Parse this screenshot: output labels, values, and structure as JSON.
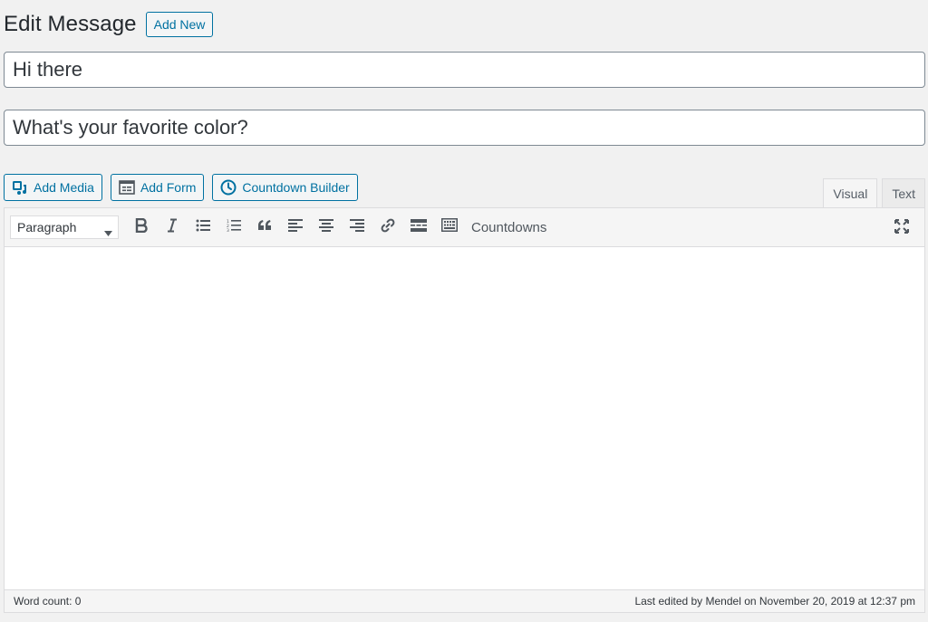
{
  "header": {
    "title": "Edit Message",
    "add_new_label": "Add New"
  },
  "fields": {
    "title_value": "Hi there",
    "subject_value": "What's your favorite color?"
  },
  "media_buttons": [
    {
      "label": "Add Media",
      "icon": "add-media-icon"
    },
    {
      "label": "Add Form",
      "icon": "form-icon"
    },
    {
      "label": "Countdown Builder",
      "icon": "clock-icon"
    }
  ],
  "tabs": {
    "visual": "Visual",
    "text": "Text",
    "active": "Visual"
  },
  "toolbar": {
    "format_selected": "Paragraph",
    "buttons": [
      "bold-icon",
      "italic-icon",
      "bulleted-list-icon",
      "numbered-list-icon",
      "blockquote-icon",
      "align-left-icon",
      "align-center-icon",
      "align-right-icon",
      "link-icon",
      "read-more-icon",
      "toolbar-toggle-icon"
    ],
    "countdowns_label": "Countdowns",
    "fullscreen_icon": "fullscreen-icon"
  },
  "status": {
    "word_count": "Word count: 0",
    "last_edited": "Last edited by Mendel on November 20, 2019 at 12:37 pm"
  },
  "colors": {
    "accent": "#0071a1",
    "background": "#f1f1f1",
    "toolbar": "#f5f5f5"
  }
}
